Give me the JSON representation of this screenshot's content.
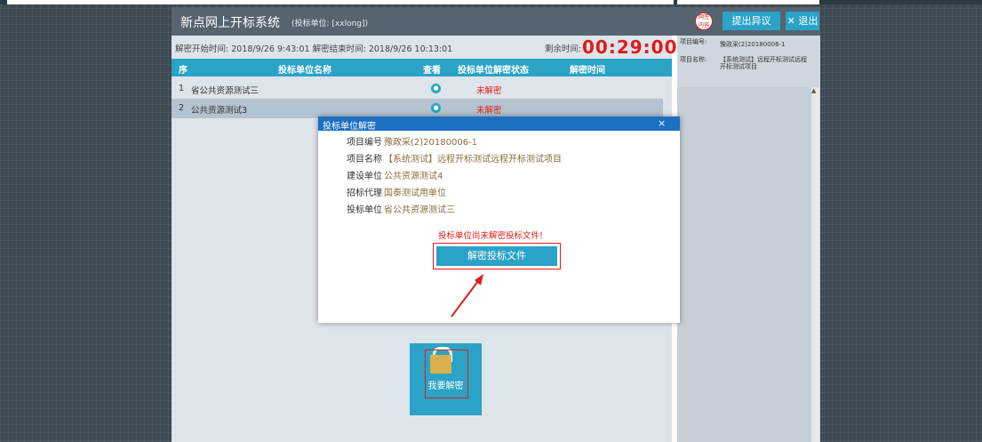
{
  "header": {
    "title": "新点网上开标系统",
    "unit_text": "(投标单位: [xxlong])",
    "seal_text": "网签 内容",
    "objection_btn": "提出异议",
    "exit_btn": "✕ 退出"
  },
  "timebar": {
    "times": "解密开始时间: 2018/9/26 9:43:01   解密结束时间: 2018/9/26 10:13:01",
    "remaining_label": "剩余时间:",
    "remaining_value": "00:29:00"
  },
  "table": {
    "headers": {
      "seq": "序",
      "name": "投标单位名称",
      "view": "查看",
      "status": "投标单位解密状态",
      "time": "解密时间"
    },
    "rows": [
      {
        "seq": "1",
        "name": "省公共资源测试三",
        "status": "未解密"
      },
      {
        "seq": "2",
        "name": "公共资源测试3",
        "status": "未解密"
      }
    ]
  },
  "right": {
    "proj_no_label": "项目编号:",
    "proj_no": "豫政采(2)20180006-1",
    "proj_name_label": "项目名称:",
    "proj_name": "【系统测试】远程开标测试远程开标测试项目"
  },
  "modal": {
    "title": "投标单位解密",
    "close": "×",
    "fields": [
      {
        "label": "项目编号",
        "value": "豫政采(2)20180006-1"
      },
      {
        "label": "项目名称",
        "value": "【系统测试】远程开标测试远程开标测试项目"
      },
      {
        "label": "建设单位",
        "value": "公共资源测试4"
      },
      {
        "label": "招标代理",
        "value": "国泰测试用单位"
      },
      {
        "label": "投标单位",
        "value": "省公共资源测试三"
      }
    ],
    "warning": "投标单位尚未解密投标文件!",
    "decrypt_btn": "解密投标文件"
  },
  "unlock": {
    "label": "我要解密"
  },
  "colors": {
    "accent": "#2aa3c7",
    "header": "#566470",
    "danger": "#e01b1b",
    "modal_header": "#1c6fc1"
  },
  "icons": {
    "view": "user-icon",
    "lock": "lock-icon",
    "seal": "seal-icon"
  }
}
